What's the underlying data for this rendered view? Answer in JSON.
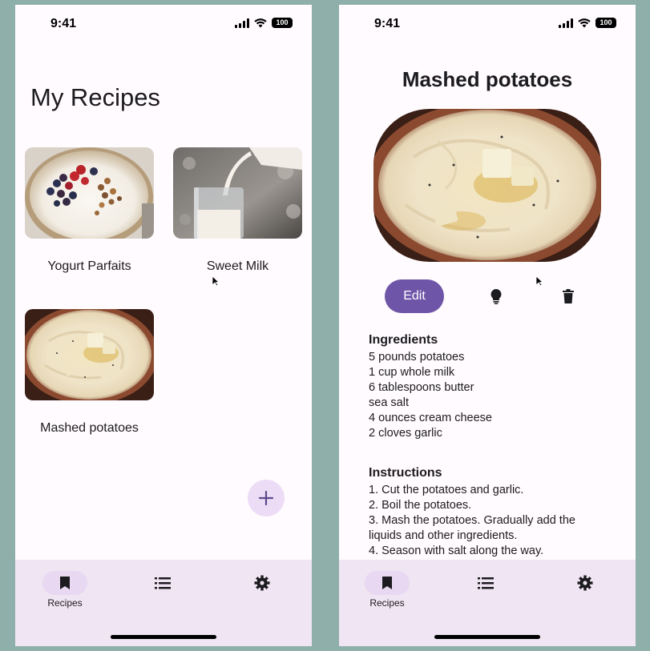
{
  "status_bar": {
    "time": "9:41",
    "battery": "100"
  },
  "recipes_screen": {
    "title": "My Recipes",
    "recipes": [
      {
        "name": "Yogurt Parfaits",
        "image": "yogurt-parfait-photo"
      },
      {
        "name": "Sweet Milk",
        "image": "milk-pouring-photo"
      },
      {
        "name": "Mashed potatoes",
        "image": "mashed-potatoes-photo"
      }
    ],
    "fab_icon": "plus-icon"
  },
  "detail_screen": {
    "title": "Mashed potatoes",
    "image": "mashed-potatoes-photo",
    "edit_label": "Edit",
    "actions": [
      "lightbulb-icon",
      "trash-icon"
    ],
    "ingredients_heading": "Ingredients",
    "ingredients": [
      "5 pounds potatoes",
      "1 cup whole milk",
      "6 tablespoons butter",
      "sea salt",
      "4 ounces cream cheese",
      "2 cloves garlic"
    ],
    "instructions_heading": "Instructions",
    "instructions": [
      "1. Cut the potatoes and garlic.",
      "2. Boil the potatoes.",
      "3. Mash the potatoes. Gradually add the liquids and other ingredients.",
      "4. Season with salt along the way."
    ]
  },
  "nav": {
    "items": [
      {
        "label": "Recipes",
        "icon": "bookmark-icon",
        "active": true
      },
      {
        "label": "",
        "icon": "list-icon",
        "active": false
      },
      {
        "label": "",
        "icon": "gear-icon",
        "active": false
      }
    ]
  },
  "colors": {
    "background": "#8fb0aa",
    "surface": "#fffbfe",
    "primary": "#6f55a7",
    "nav_bar": "#f0e5f3",
    "fab": "#ecdcf5"
  }
}
